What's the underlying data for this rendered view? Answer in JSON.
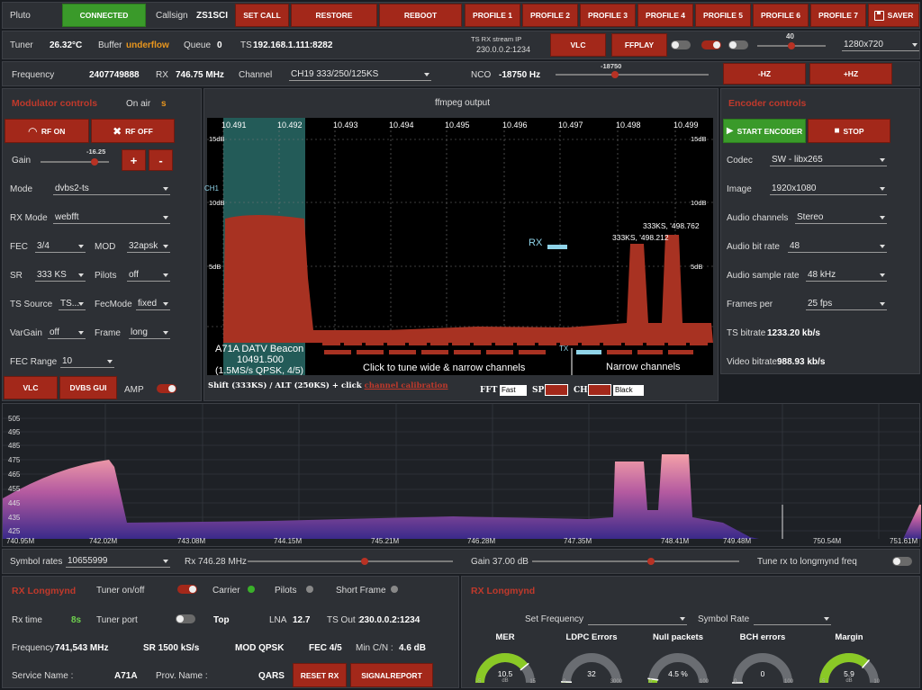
{
  "top": {
    "device": "Pluto",
    "connected": "CONNECTED",
    "callsign_label": "Callsign",
    "callsign": "ZS1SCI",
    "set_call": "SET CALL",
    "restore": "RESTORE",
    "reboot": "REBOOT",
    "profiles": [
      "PROFILE 1",
      "PROFILE 2",
      "PROFILE 3",
      "PROFILE 4",
      "PROFILE 5",
      "PROFILE 6",
      "PROFILE 7"
    ],
    "saver": "SAVER"
  },
  "status": {
    "tuner_label": "Tuner",
    "tuner_temp": "26.32°C",
    "buffer_label": "Buffer",
    "buffer": "underflow",
    "queue_label": "Queue",
    "queue": "0",
    "ts_label": "TS",
    "ts": "192.168.1.111:8282",
    "stream_ip_label": "TS RX stream IP",
    "stream_ip": "230.0.0.2:1234",
    "vlc": "VLC",
    "ffplay": "FFPLAY",
    "slider_value": "40",
    "resolution": "1280x720"
  },
  "freqbar": {
    "freq_label": "Frequency",
    "freq": "2407749888",
    "rx_label": "RX",
    "rx": "746.75 MHz",
    "channel_label": "Channel",
    "channel": "CH19 333/250/125KS",
    "nco_label": "NCO",
    "nco": "-18750 Hz",
    "nco_slider": "-18750",
    "minus_hz": "-HZ",
    "plus_hz": "+HZ"
  },
  "modulator": {
    "title": "Modulator controls",
    "onair_label": "On air",
    "onair": "s",
    "rf_on": "RF ON",
    "rf_off": "RF OFF",
    "gain_label": "Gain",
    "gain": "-16.25",
    "plus": "+",
    "minus": "-",
    "mode_label": "Mode",
    "mode": "dvbs2-ts",
    "rxmode_label": "RX Mode",
    "rxmode": "webfft",
    "fec_label": "FEC",
    "fec": "3/4",
    "mod_label": "MOD",
    "mod": "32apsk",
    "sr_label": "SR",
    "sr": "333 KS",
    "pilots_label": "Pilots",
    "pilots": "off",
    "tssource_label": "TS Source",
    "tssource": "TS...",
    "fecmode_label": "FecMode",
    "fecmode": "fixed",
    "vargain_label": "VarGain",
    "vargain": "off",
    "frame_label": "Frame",
    "frame": "long",
    "fecrange_label": "FEC Range",
    "fecrange": "10",
    "vlc": "VLC",
    "dvbs_gui": "DVBS GUI",
    "amp": "AMP"
  },
  "ffmpeg": {
    "title": "ffmpeg output",
    "freqs": [
      "10.491",
      "10.492",
      "10.493",
      "10.494",
      "10.495",
      "10.496",
      "10.497",
      "10.498",
      "10.499"
    ],
    "db": [
      "15dB",
      "10dB",
      "5dB"
    ],
    "ch1": "CH1",
    "rx_marker": "RX",
    "tx_marker": "TX",
    "peak1": "333KS, '498.762",
    "peak2": "333KS, '498.212",
    "beacon1": "A71A DATV Beacon",
    "beacon2": "10491.500",
    "beacon3": "(1.5MS/s QPSK, 4/5)",
    "tune_hint": "Click to tune wide & narrow channels",
    "narrow": "Narrow channels",
    "shift_hint": "Shift (333KS) / ALT (250KS) + click ",
    "calib": "channel calibration",
    "fft_label": "FFT",
    "fft": "Fast",
    "sp_label": "SP",
    "ch_label": "CH",
    "ch_color": "Black"
  },
  "encoder": {
    "title": "Encoder controls",
    "start": "START ENCODER",
    "stop": "STOP",
    "codec_label": "Codec",
    "codec": "SW - libx265",
    "image_label": "Image",
    "image": "1920x1080",
    "achan_label": "Audio channels",
    "achan": "Stereo",
    "abit_label": "Audio bit rate",
    "abit": "48",
    "asr_label": "Audio sample rate",
    "asr": "48 kHz",
    "fps_label": "Frames per",
    "fps": "25 fps",
    "tsbit_label": "TS bitrate",
    "tsbit": "1233.20 kb/s",
    "vbit_label": "Video bitrate",
    "vbit": "988.93 kb/s"
  },
  "spectrum": {
    "y_ticks": [
      "505",
      "495",
      "485",
      "475",
      "465",
      "455",
      "445",
      "435",
      "425"
    ],
    "x_ticks": [
      "740.95M",
      "742.02M",
      "743.08M",
      "744.15M",
      "745.21M",
      "746.28M",
      "747.35M",
      "748.41M",
      "749.48M",
      "750.54M",
      "751.61M"
    ]
  },
  "controls": {
    "symrate_label": "Symbol rates",
    "symrate": "10655999",
    "rx": "Rx 746.28 MHz",
    "gain": "Gain 37.00 dB",
    "tune_label": "Tune rx to longmynd freq"
  },
  "longmynd": {
    "title": "RX Longmynd",
    "tuner_onoff": "Tuner on/off",
    "carrier": "Carrier",
    "pilots": "Pilots",
    "short_frame": "Short Frame",
    "rx_time_label": "Rx time",
    "rx_time": "8s",
    "tuner_port": "Tuner port",
    "port": "Top",
    "lna_label": "LNA",
    "lna": "12.7",
    "tsout_label": "TS Out :",
    "tsout": "230.0.0.2:1234",
    "freq_label": "Frequency",
    "freq": "741,543 MHz",
    "sr": "SR 1500 kS/s",
    "mod": "MOD QPSK",
    "fec": "FEC 4/5",
    "mincn_label": "Min C/N :",
    "mincn": "4.6 dB",
    "service_label": "Service Name :",
    "service": "A71A",
    "prov_label": "Prov. Name :",
    "prov": "QARS",
    "reset": "RESET RX",
    "signal": "SIGNALREPORT"
  },
  "rxright": {
    "title": "RX Longmynd",
    "setfreq": "Set Frequency",
    "symrate": "Symbol Rate",
    "gauges": [
      {
        "name": "MER",
        "value": "10.5",
        "unit": "dB",
        "min": "-5",
        "max": "15",
        "fill": 0.78,
        "color": "#8ac926"
      },
      {
        "name": "LDPC Errors",
        "value": "32",
        "unit": "",
        "min": "0",
        "max": "3000",
        "fill": 0.01,
        "color": "#8ac926"
      },
      {
        "name": "Null packets",
        "value": "4.5 %",
        "unit": "",
        "min": "0",
        "max": "100",
        "fill": 0.045,
        "color": "#8ac926"
      },
      {
        "name": "BCH errors",
        "value": "0",
        "unit": "",
        "min": "0",
        "max": "100",
        "fill": 0.0,
        "color": "#8ac926"
      },
      {
        "name": "Margin",
        "value": "5.9",
        "unit": "dB",
        "min": "-5",
        "max": "10",
        "fill": 0.73,
        "color": "#8ac926"
      }
    ]
  },
  "colors": {
    "accent": "#a3281a",
    "connected": "#3a9a2a",
    "title_red": "#c0392b"
  }
}
